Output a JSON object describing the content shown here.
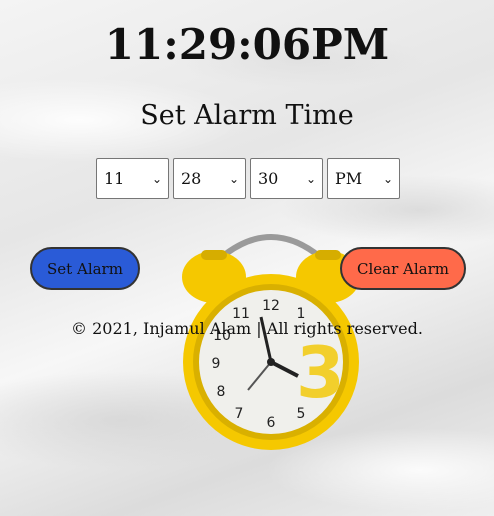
{
  "clock": {
    "time": "11:29:06PM"
  },
  "alarm": {
    "heading": "Set Alarm Time",
    "hour": "11",
    "minute": "28",
    "second": "30",
    "ampm": "PM",
    "set_label": "Set Alarm",
    "clear_label": "Clear Alarm"
  },
  "footer": {
    "text": "© 2021, Injamul Alam | All rights reserved."
  },
  "colors": {
    "set_button": "#2a5bd7",
    "clear_button": "#ff6a4a",
    "clock_body": "#f5c800"
  },
  "icons": {
    "chevron": "chevron-down-icon",
    "background": "alarm-clock-image"
  }
}
